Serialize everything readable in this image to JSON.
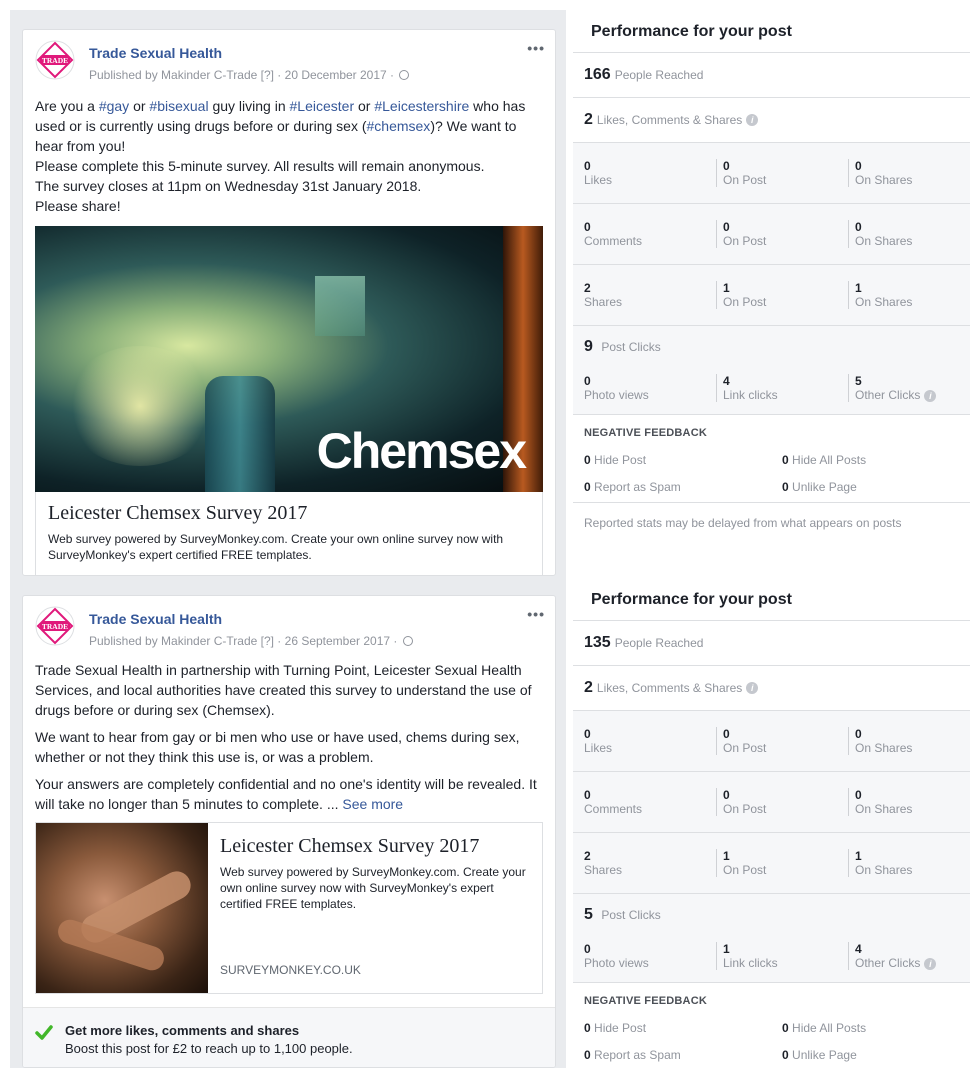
{
  "posts": [
    {
      "page_name": "Trade Sexual Health",
      "avatar_text": "TRADE",
      "meta": "Published by Makinder C-Trade [?] · 20 December 2017 ·",
      "more": "•••",
      "text_parts": {
        "p1_a": "Are you a ",
        "tag_gay": "#gay",
        "p1_b": " or ",
        "tag_bisexual": "#bisexual",
        "p1_c": " guy living in ",
        "tag_leicester": "#Leicester",
        "p1_d": " or ",
        "tag_leicestershire": "#Leicestershire",
        "p1_e": " who has used or is currently using drugs before or during sex (",
        "tag_chemsex": "#chemsex",
        "p1_f": ")? We want to hear from you!",
        "line2": "Please complete this 5-minute survey. All results will remain anonymous.",
        "line3": "The survey closes at 11pm on Wednesday 31st January 2018.",
        "line4": "Please share!"
      },
      "image_text": "Chemsex",
      "link_title": "Leicester Chemsex Survey 2017",
      "link_desc": "Web survey powered by SurveyMonkey.com. Create your own online survey now with SurveyMonkey's expert certified FREE templates."
    },
    {
      "page_name": "Trade Sexual Health",
      "avatar_text": "TRADE",
      "meta": "Published by Makinder C-Trade [?] · 26 September 2017 ·",
      "more": "•••",
      "para1": "Trade Sexual Health in partnership with Turning Point, Leicester Sexual Health Services, and local authorities have created this survey to understand the use of drugs before or during sex (Chemsex).",
      "para2": "We want to hear from gay or bi men who use or have used, chems during sex, whether or not they think this use is, or was a problem.",
      "para3": "Your answers are completely confidential and no one's identity will be revealed. It will take no longer than 5 minutes to complete. ...",
      "see_more": "See more",
      "link_title": "Leicester Chemsex Survey 2017",
      "link_desc": "Web survey powered by SurveyMonkey.com. Create your own online survey now with SurveyMonkey's expert certified FREE templates.",
      "link_domain": "SURVEYMONKEY.CO.UK",
      "boost_title": "Get more likes, comments and shares",
      "boost_sub": "Boost this post for £2 to reach up to 1,100 people."
    }
  ],
  "performance": [
    {
      "title": "Performance for your post",
      "reached": "166",
      "reached_label": "People Reached",
      "lcs": "2",
      "lcs_label": "Likes, Comments & Shares",
      "likes": {
        "total": "0",
        "label": "Likes",
        "on_post": "0",
        "on_post_label": "On Post",
        "on_shares": "0",
        "on_shares_label": "On Shares"
      },
      "comments": {
        "total": "0",
        "label": "Comments",
        "on_post": "0",
        "on_post_label": "On Post",
        "on_shares": "0",
        "on_shares_label": "On Shares"
      },
      "shares": {
        "total": "2",
        "label": "Shares",
        "on_post": "1",
        "on_post_label": "On Post",
        "on_shares": "1",
        "on_shares_label": "On Shares"
      },
      "post_clicks": "9",
      "post_clicks_label": "Post Clicks",
      "photo_views": "0",
      "photo_views_label": "Photo views",
      "link_clicks": "4",
      "link_clicks_label": "Link clicks",
      "other_clicks": "5",
      "other_clicks_label": "Other Clicks",
      "negative_label": "NEGATIVE FEEDBACK",
      "hide_post": "0",
      "hide_post_label": "Hide Post",
      "hide_all": "0",
      "hide_all_label": "Hide All Posts",
      "spam": "0",
      "spam_label": "Report as Spam",
      "unlike": "0",
      "unlike_label": "Unlike Page",
      "delay_note": "Reported stats may be delayed from what appears on posts"
    },
    {
      "title": "Performance for your post",
      "reached": "135",
      "reached_label": "People Reached",
      "lcs": "2",
      "lcs_label": "Likes, Comments & Shares",
      "likes": {
        "total": "0",
        "label": "Likes",
        "on_post": "0",
        "on_post_label": "On Post",
        "on_shares": "0",
        "on_shares_label": "On Shares"
      },
      "comments": {
        "total": "0",
        "label": "Comments",
        "on_post": "0",
        "on_post_label": "On Post",
        "on_shares": "0",
        "on_shares_label": "On Shares"
      },
      "shares": {
        "total": "2",
        "label": "Shares",
        "on_post": "1",
        "on_post_label": "On Post",
        "on_shares": "1",
        "on_shares_label": "On Shares"
      },
      "post_clicks": "5",
      "post_clicks_label": "Post Clicks",
      "photo_views": "0",
      "photo_views_label": "Photo views",
      "link_clicks": "1",
      "link_clicks_label": "Link clicks",
      "other_clicks": "4",
      "other_clicks_label": "Other Clicks",
      "negative_label": "NEGATIVE FEEDBACK",
      "hide_post": "0",
      "hide_post_label": "Hide Post",
      "hide_all": "0",
      "hide_all_label": "Hide All Posts",
      "spam": "0",
      "spam_label": "Report as Spam",
      "unlike": "0",
      "unlike_label": "Unlike Page"
    }
  ],
  "colors": {
    "link_blue": "#365899",
    "avatar_pink": "#e0197b",
    "boost_green": "#42b72a",
    "panel_grey": "#f6f7f9"
  },
  "icons": {
    "info": "info-icon",
    "globe": "globe-icon",
    "check": "checkmark-icon",
    "more": "more-options-icon"
  }
}
